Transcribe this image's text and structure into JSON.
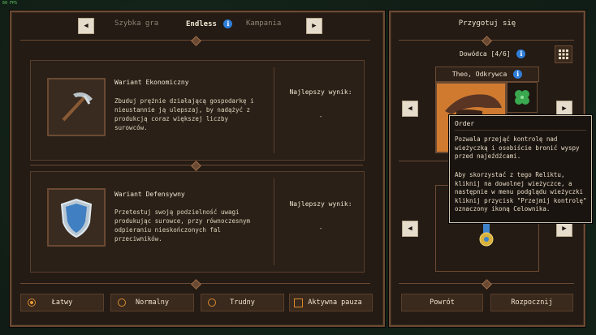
{
  "fps": "60 FPS",
  "mode_tabs": {
    "left": "Szybka gra",
    "active": "Endless",
    "right": "Kampania"
  },
  "variants": [
    {
      "title": "Wariant Ekonomiczny",
      "description": "Zbuduj prężnie działającą gospodarkę i nieustannie ją ulepszaj, by nadążyć z produkcją coraz większej liczby surowców.",
      "best_label": "Najlepszy wynik:",
      "best_value": "-",
      "selected": true,
      "icon": "pickaxe-icon"
    },
    {
      "title": "Wariant Defensywny",
      "description": "Przetestuj swoją podzielność uwagi produkując surowce, przy równoczesnym odpieraniu nieskończonych fal przeciwników.",
      "best_label": "Najlepszy wynik:",
      "best_value": "-",
      "selected": false,
      "icon": "shield-icon"
    }
  ],
  "difficulty": {
    "easy": "Łatwy",
    "normal": "Normalny",
    "hard": "Trudny",
    "active_pause": "Aktywna pauza",
    "selected": "easy"
  },
  "right": {
    "title": "Przygotuj się",
    "commander_label": "Dowódca [4/6]",
    "commander_name": "Theo, Odkrywca",
    "back": "Powrót",
    "start": "Rozpocznij"
  },
  "tooltip": {
    "title": "Order",
    "para1": "Pozwala przejąć kontrolę nad wieżyczką i osobiście bronić wyspy przed najeźdźcami.",
    "para2": "Aby skorzystać z tego Reliktu, kliknij na dowolnej wieżyczce, a następnie w menu podglądu wieżyczki kliknij przycisk \"Przejmij kontrolę\" oznaczony ikoną Celownika."
  },
  "colors": {
    "accent": "#e59a35",
    "info": "#2f7ed8",
    "border": "#6b4a33",
    "panel": "#241b14"
  }
}
